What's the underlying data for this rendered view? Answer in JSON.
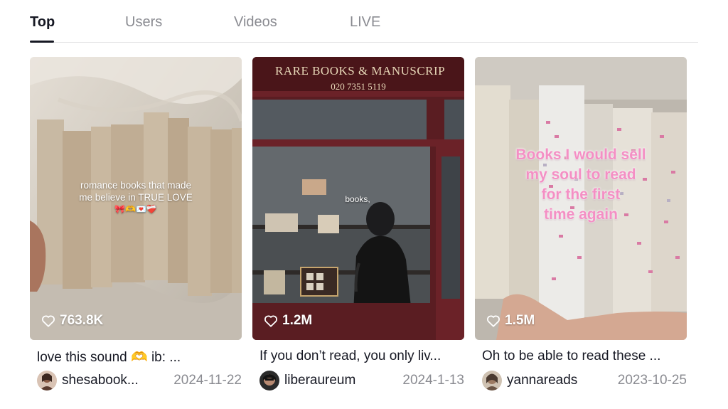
{
  "tabs": [
    {
      "label": "Top",
      "active": true
    },
    {
      "label": "Users",
      "active": false
    },
    {
      "label": "Videos",
      "active": false
    },
    {
      "label": "LIVE",
      "active": false
    }
  ],
  "cards": [
    {
      "likes": "763.8K",
      "overlay_line1": "romance books that made",
      "overlay_line2": "me believe in TRUE LOVE",
      "overlay_emoji": "🎀🫶💌❤️‍🩹",
      "caption": "love this sound 🫶 ib: ...",
      "username": "shesabook...",
      "date": "2024-11-22"
    },
    {
      "likes": "1.2M",
      "store_sign": "RARE BOOKS & MANUSCRIP",
      "store_phone": "020 7351 5119",
      "overlay_text": "books,",
      "caption": "If you don’t read, you only liv...",
      "username": "liberaureum",
      "date": "2024-1-13"
    },
    {
      "likes": "1.5M",
      "overlay_line1": "Books I would sell",
      "overlay_line2": "my soul to read",
      "overlay_line3": "for the first",
      "overlay_line4": "time again",
      "caption": "Oh to be able to read these ...",
      "username": "yannareads",
      "date": "2023-10-25"
    }
  ],
  "icons": {
    "likes": "heart-outline-icon"
  },
  "colors": {
    "text_primary": "#161823",
    "text_secondary": "#8a8b91",
    "overlay_pink": "#f48fc4"
  }
}
